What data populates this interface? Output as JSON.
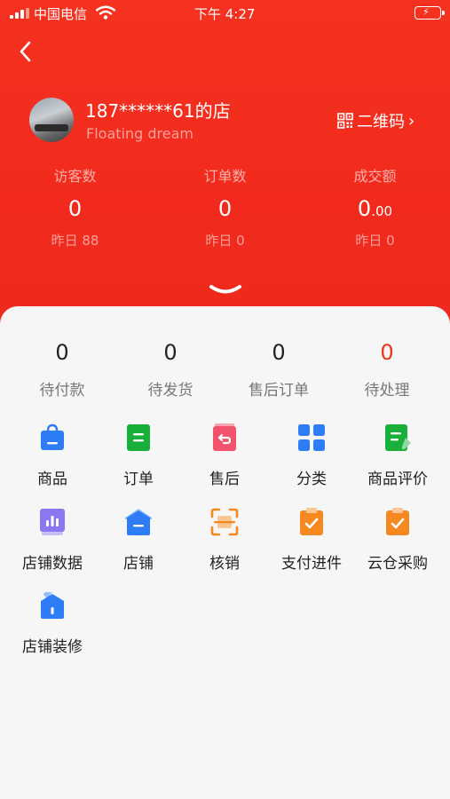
{
  "status_bar": {
    "carrier": "中国电信",
    "time": "下午 4:27"
  },
  "header": {
    "store_name": "187******61的店",
    "store_subtitle": "Floating dream",
    "qr_label": "二维码",
    "qr_chevron": "›"
  },
  "metrics": [
    {
      "label": "访客数",
      "value": "0",
      "value_decimals": "",
      "yesterday": "昨日 88"
    },
    {
      "label": "订单数",
      "value": "0",
      "value_decimals": "",
      "yesterday": "昨日 0"
    },
    {
      "label": "成交额",
      "value": "0",
      "value_decimals": ".00",
      "yesterday": "昨日 0"
    }
  ],
  "order_counts": [
    {
      "label": "待付款",
      "value": "0"
    },
    {
      "label": "待发货",
      "value": "0"
    },
    {
      "label": "售后订单",
      "value": "0"
    },
    {
      "label": "待处理",
      "value": "0"
    }
  ],
  "menu": [
    {
      "label": "商品",
      "icon": "shopping-bag-icon"
    },
    {
      "label": "订单",
      "icon": "order-list-icon"
    },
    {
      "label": "售后",
      "icon": "after-sale-icon"
    },
    {
      "label": "分类",
      "icon": "category-grid-icon"
    },
    {
      "label": "商品评价",
      "icon": "review-icon"
    },
    {
      "label": "店铺数据",
      "icon": "bar-chart-icon"
    },
    {
      "label": "店铺",
      "icon": "store-icon"
    },
    {
      "label": "核销",
      "icon": "scan-icon"
    },
    {
      "label": "支付进件",
      "icon": "payment-clipboard-icon"
    },
    {
      "label": "云仓采购",
      "icon": "purchase-clipboard-icon"
    },
    {
      "label": "店铺装修",
      "icon": "store-decor-icon"
    }
  ],
  "colors": {
    "header_red": "#f12a1d",
    "alert_red": "#e8361f",
    "blue": "#2f7df6",
    "green": "#18b03a",
    "pink": "#f0536b",
    "purple": "#8a78f0",
    "orange": "#f5891f"
  }
}
